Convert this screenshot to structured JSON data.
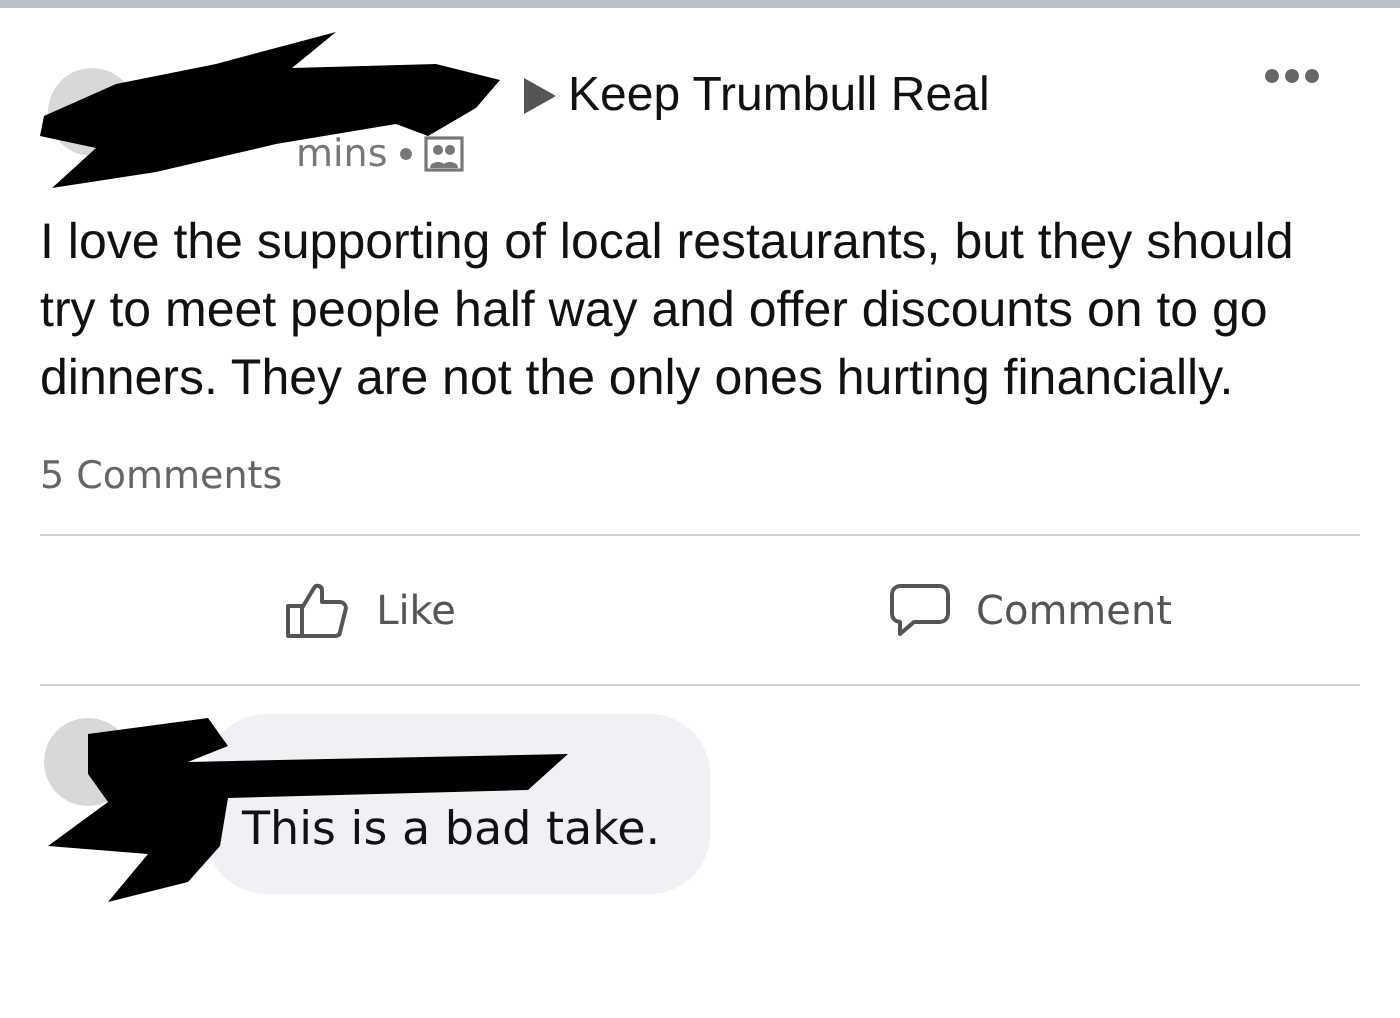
{
  "post": {
    "group": "Keep Trumbull Real",
    "time": "mins",
    "text": "I love the supporting of local restaurants, but they should try to meet people half way and offer discounts on to go dinners. They are not the only ones hurting financially.",
    "comment_count": "5 Comments"
  },
  "actions": [
    {
      "kind": "like",
      "label": "Like"
    },
    {
      "kind": "comment",
      "label": "Comment"
    }
  ],
  "comments": [
    {
      "text": "This is a bad take."
    }
  ]
}
